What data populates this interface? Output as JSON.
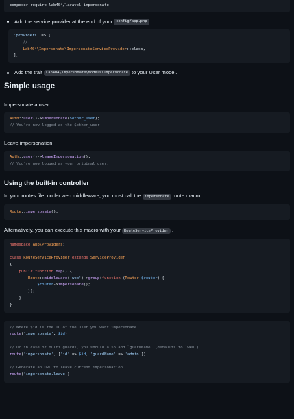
{
  "composer_block": {
    "line1": "composer require lab404/laravel-impersonate"
  },
  "install": {
    "bullet1_text": "Add the service provider at the end of your",
    "bullet1_code": "config/app.php",
    "bullet1_suffix": ":",
    "providers_block": {
      "l1_key": "'providers'",
      "l1_rest": " => [",
      "l2": "    // ...",
      "l3_ns": "    Lab404\\Impersonate\\ImpersonateServiceProvider",
      "l3_rest": "::class,",
      "l4": "],"
    },
    "bullet2_prefix": "Add the trait",
    "bullet2_code": "Lab404\\Impersonate\\Models\\Impersonate",
    "bullet2_suffix": "to your User model."
  },
  "simple_usage": {
    "heading": "Simple usage",
    "impersonate_label": "Impersonate a user:",
    "impersonate_code": {
      "cls": "Auth",
      "op": "::",
      "fn": "user",
      "rest1": "()->",
      "fn2": "impersonate",
      "paren_open": "(",
      "var": "$other_user",
      "paren_close": ");",
      "comment": "// You're now logged as the $other_user"
    },
    "leave_label": "Leave impersonation:",
    "leave_code": {
      "cls": "Auth",
      "op": "::",
      "fn": "user",
      "rest1": "()->",
      "fn2": "leaveImpersonation",
      "rest2": "();",
      "comment": "// You're now logged as your original user."
    }
  },
  "controller": {
    "heading": "Using the built-in controller",
    "p1_prefix": "In your routes file, under web middleware, you must call the",
    "p1_code": "impersonate",
    "p1_suffix": "route macro.",
    "route_block": {
      "cls": "Route",
      "op": "::",
      "fn": "impersonate",
      "rest": "();"
    },
    "p2_prefix": "Alternatively, you can execute this macro with your",
    "p2_code": "RouteServiceProvider",
    "p2_suffix": ".",
    "provider_block": {
      "l1_kw": "namespace",
      "l1_ns": "App\\Providers",
      "l1_end": ";",
      "l3_kw": "class",
      "l3_cls": "RouteServiceProvider",
      "l3_kw2": "extends",
      "l3_cls2": "ServiceProvider",
      "l4": "{",
      "l5_kw": "public function",
      "l5_fn": "map",
      "l5_end": "() {",
      "l6_cls": "Route",
      "l6_op": "::",
      "l6_fn": "middleware",
      "l6_p1": "(",
      "l6_str": "'web'",
      "l6_p2": ")->",
      "l6_fn2": "group",
      "l6_p3": "(",
      "l6_kw": "function",
      "l6_p4": " (",
      "l6_cls2": "Router",
      "l6_var": "$router",
      "l6_p5": ") {",
      "l7_var": "$router",
      "l7_op": "->",
      "l7_fn": "impersonate",
      "l7_end": "();",
      "l8": "        });",
      "l9": "    }",
      "l10": "}"
    },
    "routes_block": {
      "c1": "// Where $id is the ID of the user you want impersonate",
      "r1_fn": "route",
      "r1_p1": "(",
      "r1_s1": "'impersonate'",
      "r1_mid": ", ",
      "r1_var": "$id",
      "r1_end": ")",
      "c2": "// Or in case of multi guards, you should also add `guardName` (defaults to `web`)",
      "r2_fn": "route",
      "r2_p1": "(",
      "r2_s1": "'impersonate'",
      "r2_mid": ", [",
      "r2_s2": "'id'",
      "r2_arrow": " => ",
      "r2_var": "$id",
      "r2_comma": ", ",
      "r2_s3": "'guardName'",
      "r2_arrow2": " => ",
      "r2_s4": "'admin'",
      "r2_end": "])",
      "c3": "// Generate an URL to leave current impersonation",
      "r3_fn": "route",
      "r3_p1": "(",
      "r3_s1": "'impersonate.leave'",
      "r3_end": ")"
    }
  }
}
